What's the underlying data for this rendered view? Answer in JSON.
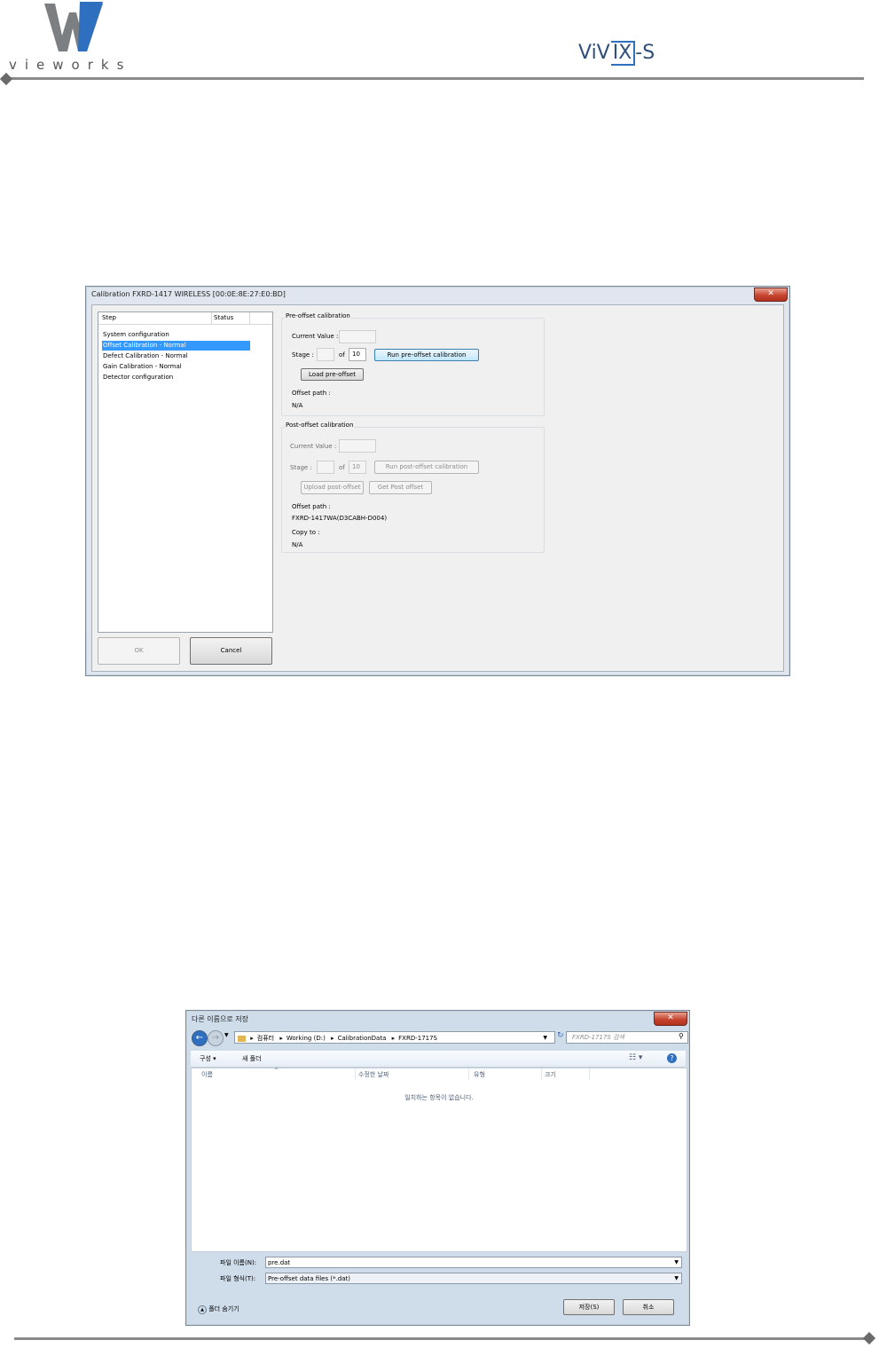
{
  "page": {
    "brand_name": "vieworks",
    "product_logo": {
      "main": "ViVIX",
      "suffix": "-S"
    }
  },
  "calibration_dialog": {
    "title": "Calibration  FXRD-1417 WIRELESS [00:0E:8E:27:E0:BD]",
    "close_icon": "close-icon",
    "step_list": {
      "columns": [
        "Step",
        "Status"
      ],
      "items": [
        "System configuration",
        "Offset Calibration - Normal",
        "Defect Calibration - Normal",
        "Gain Calibration - Normal",
        "Detector configuration"
      ],
      "selected_index": 1
    },
    "ok_label": "OK",
    "cancel_label": "Cancel",
    "pre_offset": {
      "group_title": "Pre-offset calibration",
      "current_value_label": "Current Value :",
      "current_value": "",
      "stage_label": "Stage :",
      "stage_value": "",
      "of_label": "of",
      "of_value": "10",
      "run_label": "Run pre-offset calibration",
      "load_label": "Load pre-offset",
      "offset_path_label": "Offset path :",
      "offset_path_value": "N/A"
    },
    "post_offset": {
      "group_title": "Post-offset calibration",
      "current_value_label": "Current Value :",
      "current_value": "",
      "stage_label": "Stage :",
      "stage_value": "",
      "of_label": "of",
      "of_value": "10",
      "run_label": "Run post-offset calibration",
      "upload_label": "Upload post-offset",
      "get_label": "Get Post offset",
      "offset_path_label": "Offset path :",
      "offset_path_value": "FXRD-1417WA(D3CABH-D004)",
      "copy_to_label": "Copy to :",
      "copy_to_value": "N/A"
    }
  },
  "save_dialog": {
    "title": "다른 이름으로 저장",
    "breadcrumb": [
      "컴퓨터",
      "Working (D:)",
      "CalibrationData",
      "FXRD-1717S"
    ],
    "search_placeholder": "FXRD-1717S 검색",
    "toolbar": {
      "organize_label": "구성 ▾",
      "new_folder_label": "새 폴더"
    },
    "columns": [
      "이름",
      "수정한 날짜",
      "유형",
      "크기"
    ],
    "empty_message": "일치하는 항목이 없습니다.",
    "filename_label": "파일 이름(N):",
    "filename_value": "pre.dat",
    "filetype_label": "파일 형식(T):",
    "filetype_value": "Pre-offset data files (*.dat)",
    "hide_folders_label": "폴더 숨기기",
    "save_label": "저장(S)",
    "cancel_label": "취소"
  }
}
